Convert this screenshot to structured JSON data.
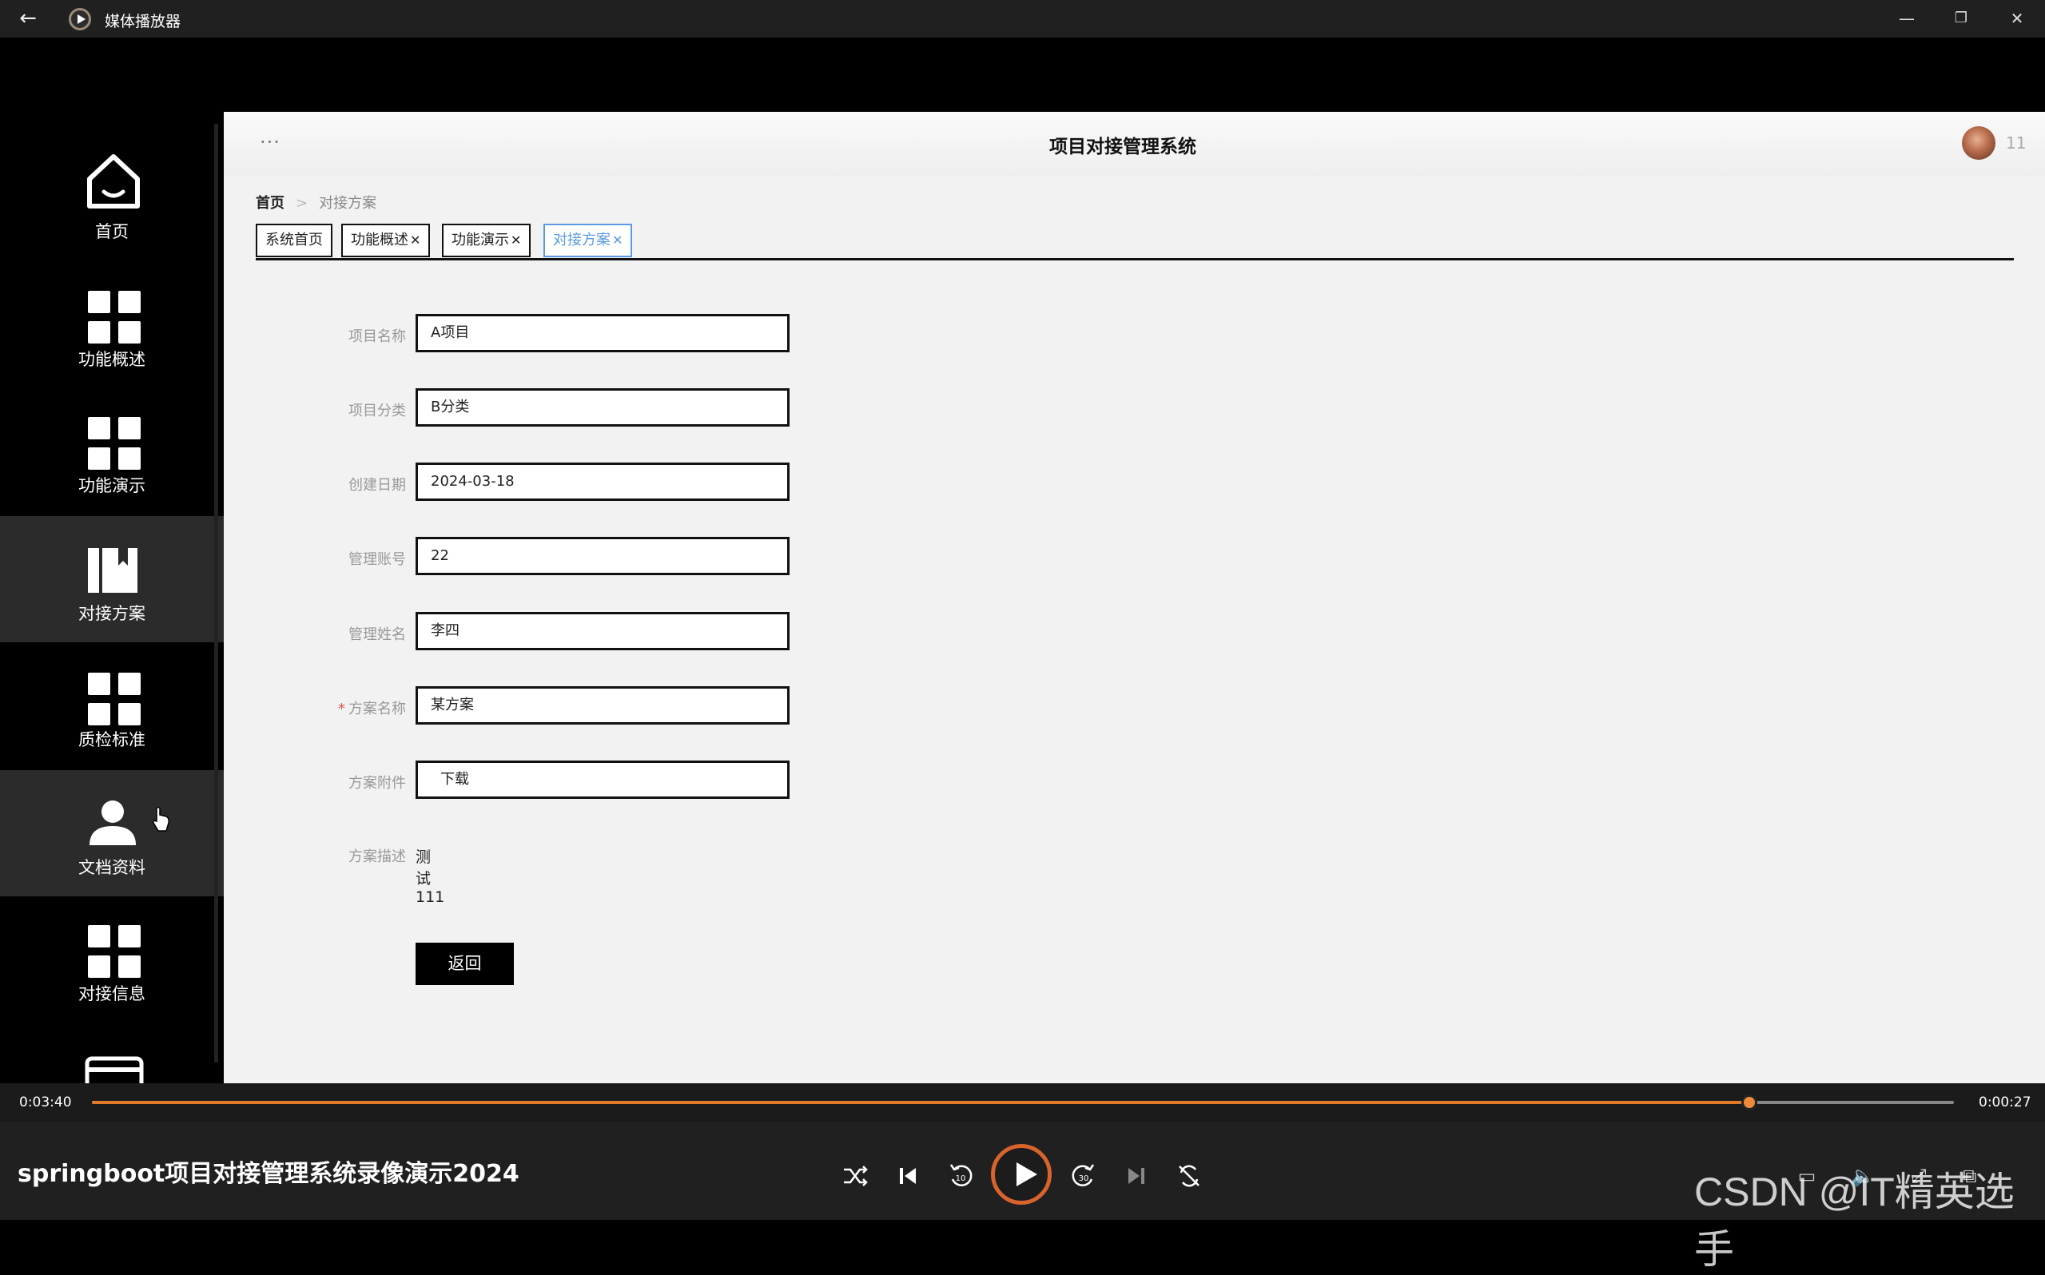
{
  "titlebar": {
    "app_name": "媒体播放器",
    "back_icon": "←",
    "minimize": "—",
    "restore": "❐",
    "close": "✕"
  },
  "sidebar": {
    "items": [
      {
        "label": "首页",
        "icon": "home-icon"
      },
      {
        "label": "功能概述",
        "icon": "grid-icon"
      },
      {
        "label": "功能演示",
        "icon": "grid-icon"
      },
      {
        "label": "对接方案",
        "icon": "book-icon"
      },
      {
        "label": "质检标准",
        "icon": "grid-icon"
      },
      {
        "label": "文档资料",
        "icon": "user-icon"
      },
      {
        "label": "对接信息",
        "icon": "grid-icon"
      }
    ]
  },
  "header": {
    "menu_dots": "···",
    "title": "项目对接管理系统",
    "user_count": "11"
  },
  "breadcrumb": {
    "home": "首页",
    "separator": ">",
    "current": "对接方案"
  },
  "tabs": [
    {
      "label": "系统首页",
      "closable": false
    },
    {
      "label": "功能概述",
      "closable": true
    },
    {
      "label": "功能演示",
      "closable": true
    },
    {
      "label": "对接方案",
      "closable": true
    }
  ],
  "form": {
    "fields": [
      {
        "label": "项目名称",
        "value": "A项目"
      },
      {
        "label": "项目分类",
        "value": "B分类"
      },
      {
        "label": "创建日期",
        "value": "2024-03-18"
      },
      {
        "label": "管理账号",
        "value": "22"
      },
      {
        "label": "管理姓名",
        "value": "李四"
      },
      {
        "label": "方案名称",
        "value": "某方案",
        "required": true
      },
      {
        "label": "方案附件",
        "value": "下载"
      },
      {
        "label": "方案描述",
        "value": "测试111"
      }
    ],
    "back_button": "返回"
  },
  "player": {
    "time_elapsed": "0:03:40",
    "time_remaining": "0:00:27",
    "progress": 0.89,
    "title": "springboot项目对接管理系统录像演示2024",
    "skip_back_label": "10",
    "skip_fwd_label": "30"
  },
  "watermark": "CSDN @IT精英选手",
  "colors": {
    "accent": "#e07a2a",
    "active_tab": "#5a9ae0"
  }
}
